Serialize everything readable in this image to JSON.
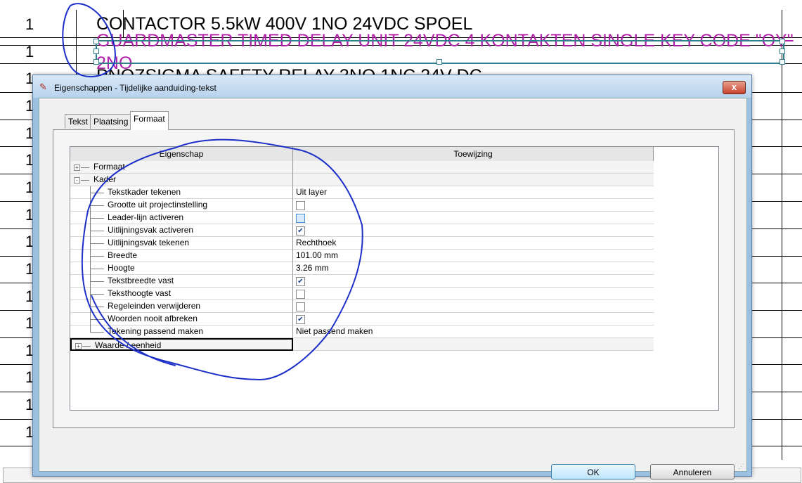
{
  "background": {
    "row_numbers": [
      "1",
      "1",
      "1",
      "1",
      "1",
      "1",
      "1",
      "1",
      "1",
      "1",
      "1",
      "1",
      "1",
      "1",
      "1",
      "1"
    ],
    "line1": "CONTACTOR 5.5kW 400V 1NO 24VDC SPOEL",
    "line2": "GUARDMASTER TIMED DELAY UNIT 24VDC 4 KONTAKTEN SINGLE KEY CODE \"OY\"",
    "line2b": "2NO",
    "line3": "PNOZSIGMA SAFETY RELAY 3NO 1NC 24V DC",
    "colors": {
      "text_black": "#000000",
      "text_magenta": "#b020a8",
      "selection": "#2f7f8f",
      "scribble": "#1c2fc8"
    }
  },
  "dialog": {
    "icon": "properties-icon",
    "title": "Eigenschappen - Tijdelijke aanduiding-tekst",
    "close_label": "x",
    "tabs": [
      {
        "label": "Tekst",
        "active": false
      },
      {
        "label": "Plaatsing",
        "active": false
      },
      {
        "label": "Formaat",
        "active": true
      }
    ],
    "grid": {
      "headers": [
        "Eigenschap",
        "Toewijzing"
      ],
      "rows": [
        {
          "name": "Formaat",
          "value": "",
          "level": 0,
          "expander": "+"
        },
        {
          "name": "Kader",
          "value": "",
          "level": 0,
          "expander": "-"
        },
        {
          "name": "Tekstkader tekenen",
          "value": "Uit layer",
          "level": 1
        },
        {
          "name": "Grootte uit projectinstelling",
          "value": "",
          "level": 1,
          "checkbox": false
        },
        {
          "name": "Leader-lijn activeren",
          "value": "",
          "level": 1,
          "checkbox": false,
          "focus": true
        },
        {
          "name": "Uitlijningsvak activeren",
          "value": "",
          "level": 1,
          "checkbox": true
        },
        {
          "name": "Uitlijningsvak tekenen",
          "value": "Rechthoek",
          "level": 1
        },
        {
          "name": "Breedte",
          "value": "101.00 mm",
          "level": 1
        },
        {
          "name": "Hoogte",
          "value": "3.26 mm",
          "level": 1
        },
        {
          "name": "Tekstbreedte vast",
          "value": "",
          "level": 1,
          "checkbox": true
        },
        {
          "name": "Teksthoogte vast",
          "value": "",
          "level": 1,
          "checkbox": false
        },
        {
          "name": "Regeleinden verwijderen",
          "value": "",
          "level": 1,
          "checkbox": false
        },
        {
          "name": "Woorden nooit afbreken",
          "value": "",
          "level": 1,
          "checkbox": true
        },
        {
          "name": "Tekening passend maken",
          "value": "Niet passend maken",
          "level": 1
        },
        {
          "name": "Waarde / eenheid",
          "value": "",
          "level": 0,
          "expander": "+",
          "selected": true
        }
      ]
    },
    "buttons": {
      "ok": "OK",
      "cancel": "Annuleren"
    }
  }
}
